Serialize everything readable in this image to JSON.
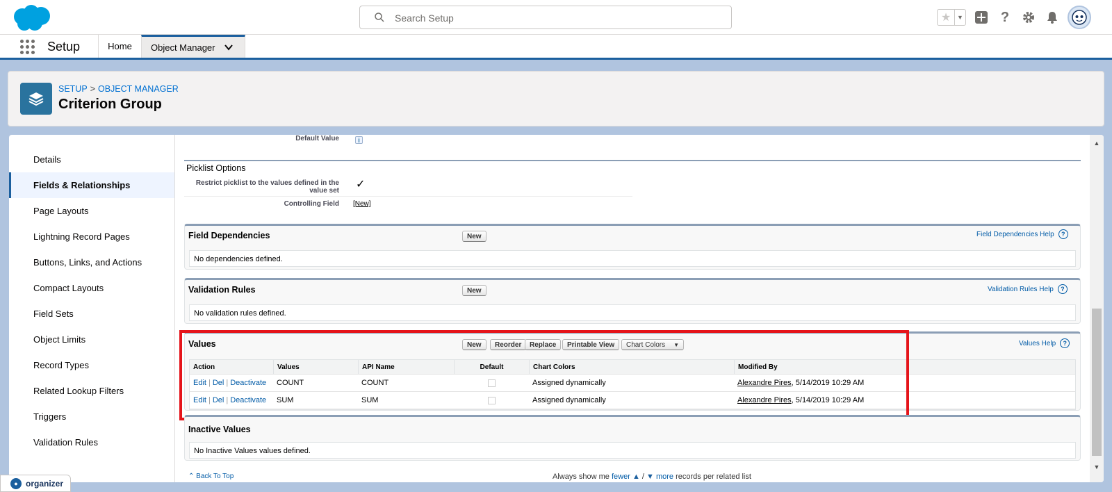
{
  "header": {
    "search_placeholder": "Search Setup"
  },
  "nav": {
    "app_name": "Setup",
    "tabs": [
      {
        "label": "Home"
      },
      {
        "label": "Object Manager"
      }
    ]
  },
  "object": {
    "breadcrumb": [
      "SETUP",
      "OBJECT MANAGER"
    ],
    "breadcrumb_sep": ">",
    "title": "Criterion Group"
  },
  "sidebar": {
    "items": [
      {
        "label": "Details"
      },
      {
        "label": "Fields & Relationships"
      },
      {
        "label": "Page Layouts"
      },
      {
        "label": "Lightning Record Pages"
      },
      {
        "label": "Buttons, Links, and Actions"
      },
      {
        "label": "Compact Layouts"
      },
      {
        "label": "Field Sets"
      },
      {
        "label": "Object Limits"
      },
      {
        "label": "Record Types"
      },
      {
        "label": "Related Lookup Filters"
      },
      {
        "label": "Triggers"
      },
      {
        "label": "Validation Rules"
      }
    ],
    "active_index": 1
  },
  "detail": {
    "default_value_label": "Default Value",
    "info_icon": "i",
    "picklist_options_title": "Picklist Options",
    "restrict_label_1": "Restrict picklist to the values defined in the",
    "restrict_label_2": "value set",
    "restrict_check": "✓",
    "controlling_field_label": "Controlling Field",
    "controlling_field_link": "[New]"
  },
  "field_dependencies": {
    "title": "Field Dependencies",
    "new_label": "New",
    "help_label": "Field Dependencies Help",
    "empty": "No dependencies defined."
  },
  "validation_rules": {
    "title": "Validation Rules",
    "new_label": "New",
    "help_label": "Validation Rules Help",
    "empty": "No validation rules defined."
  },
  "values": {
    "title": "Values",
    "buttons": {
      "new": "New",
      "reorder": "Reorder",
      "replace": "Replace",
      "printable": "Printable View",
      "chart_colors": "Chart Colors"
    },
    "help_label": "Values Help",
    "columns": [
      "Action",
      "Values",
      "API Name",
      "Default",
      "Chart Colors",
      "Modified By"
    ],
    "rows": [
      {
        "edit": "Edit",
        "del": "Del",
        "deactivate": "Deactivate",
        "value": "COUNT",
        "api": "COUNT",
        "chart": "Assigned dynamically",
        "modified_by": "Alexandre Pires",
        "modified_at": ", 5/14/2019 10:29 AM"
      },
      {
        "edit": "Edit",
        "del": "Del",
        "deactivate": "Deactivate",
        "value": "SUM",
        "api": "SUM",
        "chart": "Assigned dynamically",
        "modified_by": "Alexandre Pires",
        "modified_at": ", 5/14/2019 10:29 AM"
      }
    ]
  },
  "inactive_values": {
    "title": "Inactive Values",
    "empty": "No Inactive Values values defined."
  },
  "footer": {
    "back_to_top": "Back To Top",
    "always_show": "Always show me",
    "fewer": "fewer",
    "slash": "/",
    "more": "more",
    "suffix": "records per related list"
  },
  "organizer": {
    "label": "organizer"
  },
  "icons": {
    "search": "search-icon",
    "favorite": "star-icon",
    "add": "plus-icon",
    "help": "question-icon",
    "setup": "gear-icon",
    "notifications": "bell-icon"
  },
  "colors": {
    "brand": "#1b5f9e",
    "link": "#015ba7",
    "highlight": "#e5141a",
    "object_icon": "#2a739e"
  }
}
